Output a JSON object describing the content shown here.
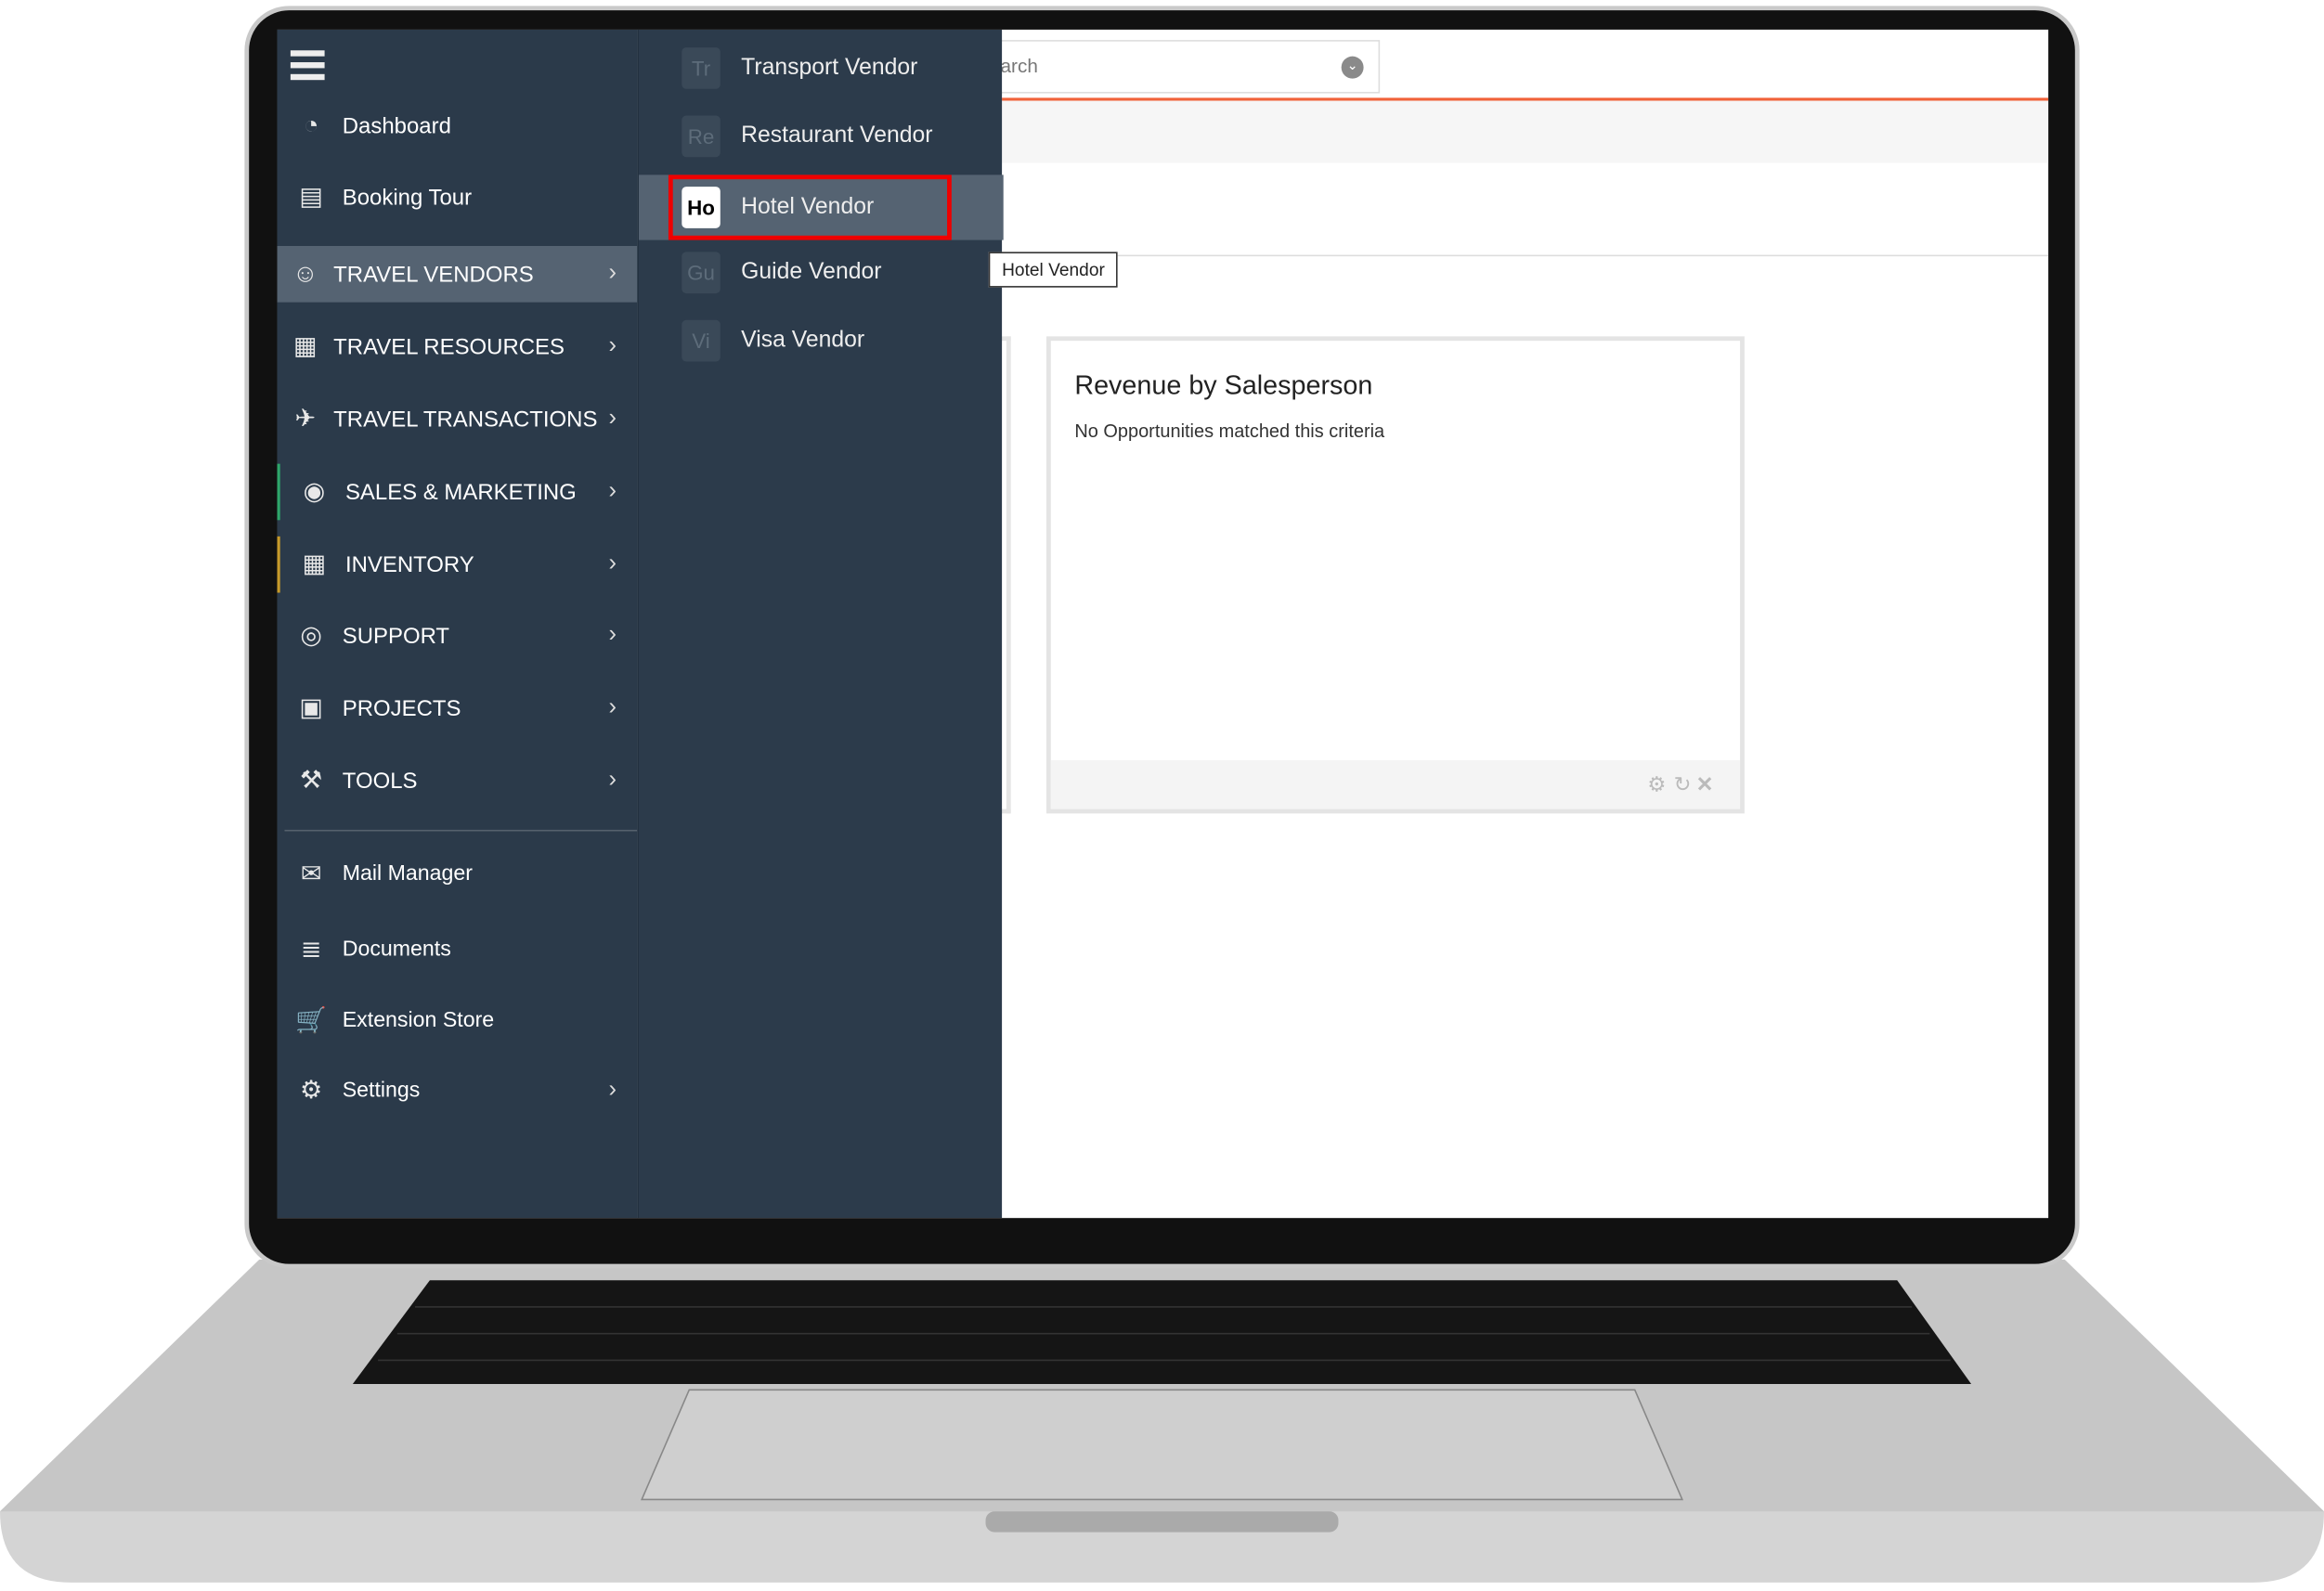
{
  "sidebar": {
    "items": [
      {
        "label": "Dashboard",
        "icon": "dashboard-icon",
        "chevron": false
      },
      {
        "label": "Booking Tour",
        "icon": "book-icon",
        "chevron": false
      },
      {
        "label": "TRAVEL VENDORS",
        "icon": "users-icon",
        "chevron": true,
        "active": true
      },
      {
        "label": "TRAVEL RESOURCES",
        "icon": "cart-dolly-icon",
        "chevron": true
      },
      {
        "label": "TRAVEL TRANSACTIONS",
        "icon": "plane-icon",
        "chevron": true
      },
      {
        "label": "SALES & MARKETING",
        "icon": "target-icon",
        "chevron": true
      },
      {
        "label": "INVENTORY",
        "icon": "cart-dolly-icon",
        "chevron": true
      },
      {
        "label": "SUPPORT",
        "icon": "lifebuoy-icon",
        "chevron": true
      },
      {
        "label": "PROJECTS",
        "icon": "briefcase-icon",
        "chevron": true
      },
      {
        "label": "TOOLS",
        "icon": "wrench-icon",
        "chevron": true
      },
      {
        "label": "Mail Manager",
        "icon": "mail-icon",
        "chevron": false
      },
      {
        "label": "Documents",
        "icon": "document-icon",
        "chevron": false
      },
      {
        "label": "Extension Store",
        "icon": "cart-icon",
        "chevron": false
      },
      {
        "label": "Settings",
        "icon": "gear-icon",
        "chevron": true
      }
    ]
  },
  "submenu": {
    "items": [
      {
        "badge": "Tr",
        "label": "Transport Vendor"
      },
      {
        "badge": "Re",
        "label": "Restaurant Vendor"
      },
      {
        "badge": "Ho",
        "label": "Hotel Vendor",
        "active": true
      },
      {
        "badge": "Gu",
        "label": "Guide Vendor"
      },
      {
        "badge": "Vi",
        "label": "Visa Vendor"
      }
    ]
  },
  "search": {
    "placeholder": "arch"
  },
  "tooltip": "Hotel Vendor",
  "widget": {
    "title": "Revenue by Salesperson",
    "message": "No Opportunities matched this criteria"
  },
  "colors": {
    "sidebar": "#2b3a4a",
    "active": "#556372",
    "accent_line": "#f0623a",
    "highlight": "#e00000"
  }
}
